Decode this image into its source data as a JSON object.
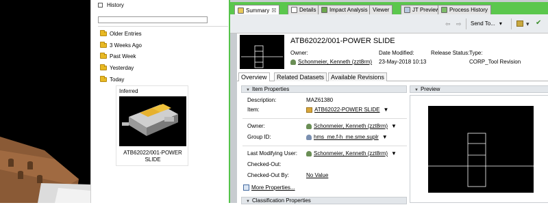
{
  "history": {
    "title": "History",
    "folders": [
      "Older Entries",
      "3 Weeks Ago",
      "Past Week",
      "Yesterday",
      "Today"
    ],
    "thumb": {
      "header": "Inferred",
      "name": "ATB62022/001-POWER SLIDE"
    }
  },
  "tabs": [
    {
      "label": "Summary",
      "active": true,
      "close": "☒"
    },
    {
      "label": "Details"
    },
    {
      "label": "Impact Analysis"
    },
    {
      "label": "Viewer"
    },
    {
      "label": "JT Preview"
    },
    {
      "label": "Process History"
    }
  ],
  "toolbar": {
    "send_to": "Send To...",
    "dropdown": "▾"
  },
  "summary": {
    "title": "ATB62022/001-POWER SLIDE",
    "owner_label": "Owner:",
    "owner_value": "Schonmeier, Kenneth (zzt8rm)",
    "date_label": "Date Modified:",
    "date_value": "23-May-2018 10:13",
    "release_label": "Release Status:",
    "type_label": "Type:",
    "type_value": "CORP_Tool Revision"
  },
  "subtabs": [
    "Overview",
    "Related Datasets",
    "Available Revisions"
  ],
  "item_properties": {
    "header": "Item Properties",
    "description_label": "Description:",
    "description_value": "MAZ61380",
    "item_label": "Item:",
    "item_value": "ATB62022-POWER SLIDE",
    "owner_label": "Owner:",
    "owner_value": "Schonmeier, Kenneth (zzt8rm)",
    "group_label": "Group ID:",
    "group_value": "hms_me.f-h_me.sme.suplr",
    "lmu_label": "Last Modifying User:",
    "lmu_value": "Schonmeier, Kenneth (zzt8rm)",
    "checked_out_label": "Checked-Out:",
    "checked_out_by_label": "Checked-Out By:",
    "checked_out_by_value": "No Value",
    "more_label": "More Properties..."
  },
  "preview": {
    "header": "Preview"
  },
  "classification": {
    "header": "Classification Properties"
  },
  "colors": {
    "accent_green": "#5bc74d",
    "viewport": "#000000",
    "section_bg": "#e2e6ea"
  }
}
